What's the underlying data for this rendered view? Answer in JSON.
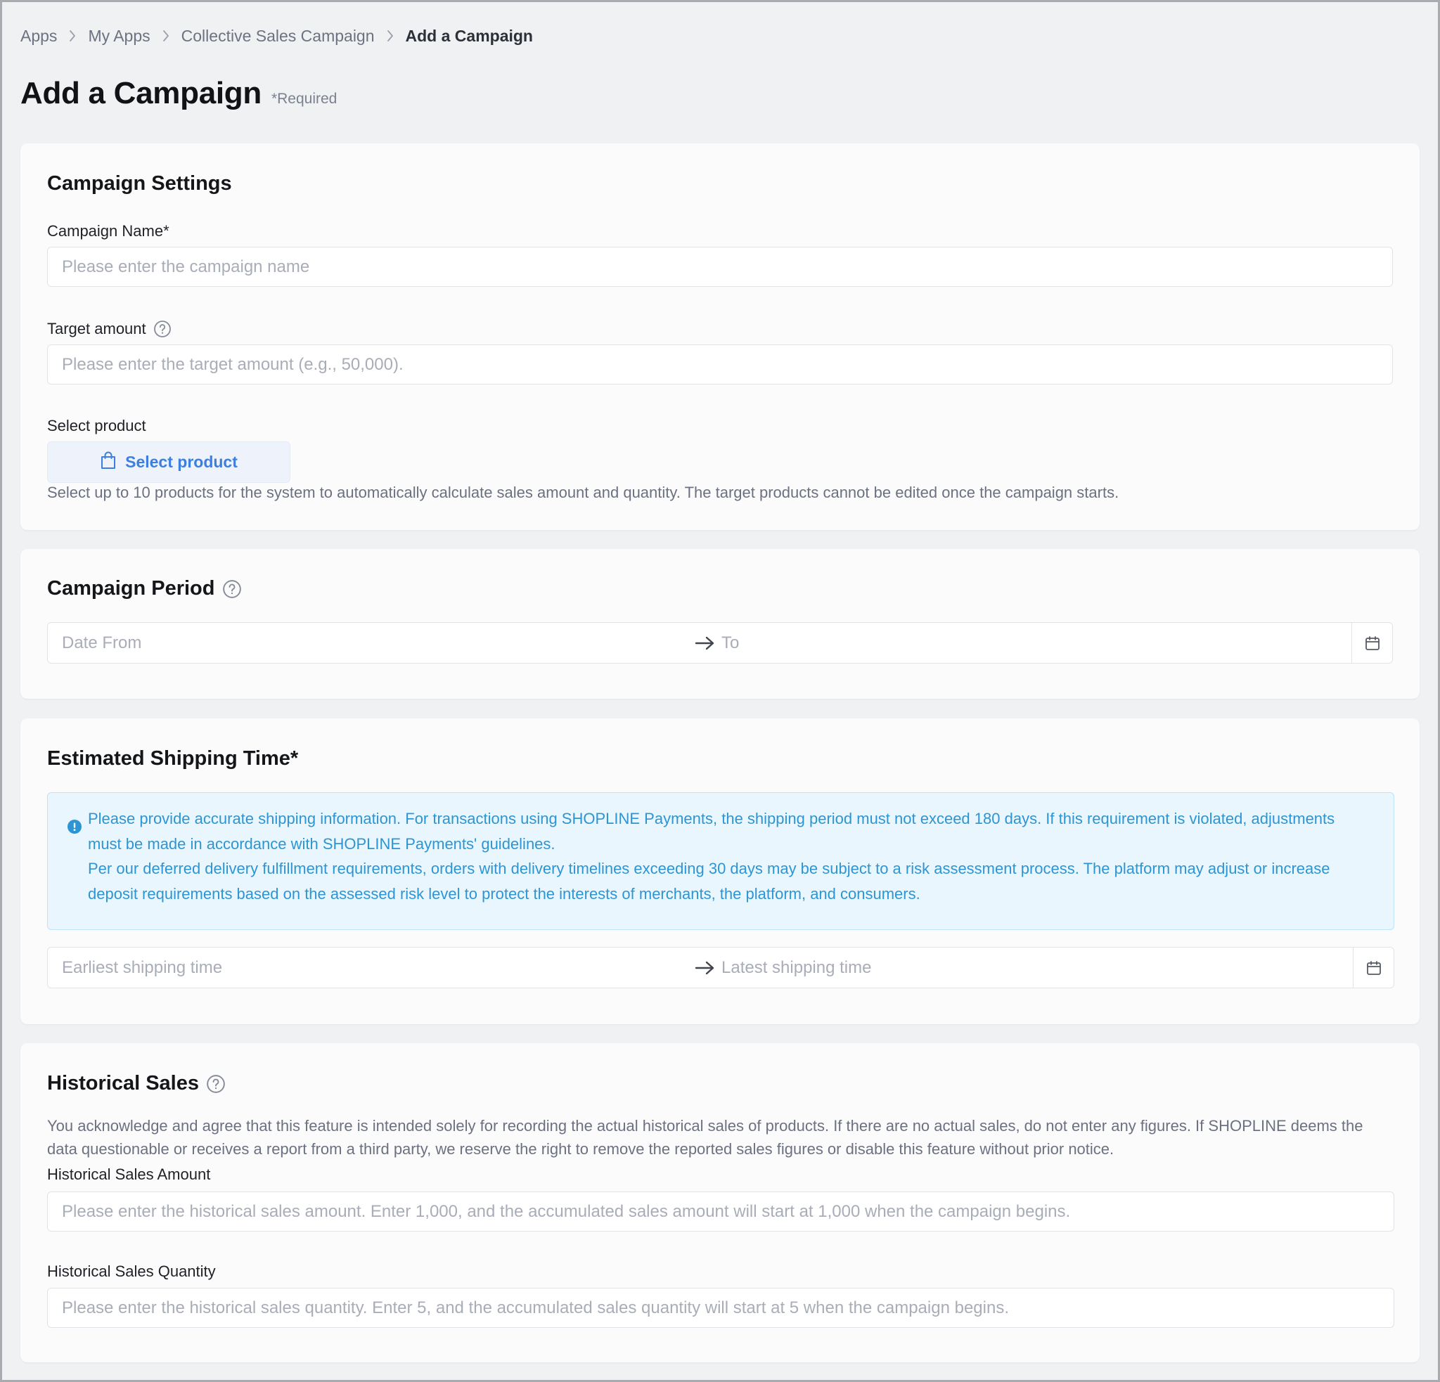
{
  "breadcrumb": [
    "Apps",
    "My Apps",
    "Collective Sales Campaign",
    "Add a Campaign"
  ],
  "page": {
    "title": "Add a Campaign",
    "required_note": "*Required"
  },
  "campaign_settings": {
    "title": "Campaign Settings",
    "name_label": "Campaign Name*",
    "name_placeholder": "Please enter the campaign name",
    "target_label": "Target amount",
    "target_placeholder": "Please enter the target amount (e.g., 50,000).",
    "product_label": "Select product",
    "product_button": "Select product",
    "product_hint": "Select up to 10 products for the system to automatically calculate sales amount and quantity. The target products cannot be edited once the campaign starts."
  },
  "campaign_period": {
    "title": "Campaign Period",
    "from_placeholder": "Date From",
    "to_placeholder": "To"
  },
  "shipping": {
    "title": "Estimated Shipping Time*",
    "notice_line1": "Please provide accurate shipping information. For transactions using SHOPLINE Payments, the shipping period must not exceed 180 days. If this requirement is violated, adjustments must be made in accordance with SHOPLINE Payments' guidelines.",
    "notice_line2": "Per our deferred delivery fulfillment requirements, orders with delivery timelines exceeding 30 days may be subject to a risk assessment process. The platform may adjust or increase deposit requirements based on the assessed risk level to protect the interests of merchants, the platform, and consumers.",
    "earliest_placeholder": "Earliest shipping time",
    "latest_placeholder": "Latest shipping time"
  },
  "historical_sales": {
    "title": "Historical Sales",
    "disclaimer": "You acknowledge and agree that this feature is intended solely for recording the actual historical sales of products. If there are no actual sales, do not enter any figures. If SHOPLINE deems the data questionable or receives a report from a third party, we reserve the right to remove the reported sales figures or disable this feature without prior notice.",
    "amount_label": "Historical Sales Amount",
    "amount_placeholder": "Please enter the historical sales amount. Enter 1,000, and the accumulated sales amount will start at 1,000 when the campaign begins.",
    "quantity_label": "Historical Sales Quantity",
    "quantity_placeholder": "Please enter the historical sales quantity. Enter 5, and the accumulated sales quantity will start at 5 when the campaign begins."
  },
  "icons": [
    "chevron-right-icon",
    "help-icon",
    "shopping-bag-icon",
    "arrow-right-icon",
    "calendar-icon",
    "info-icon"
  ],
  "colors": {
    "accent": "#3c7fe0",
    "notice_text": "#2d95d3",
    "notice_bg": "#eaf6fd",
    "page_bg": "#f0f1f3"
  }
}
